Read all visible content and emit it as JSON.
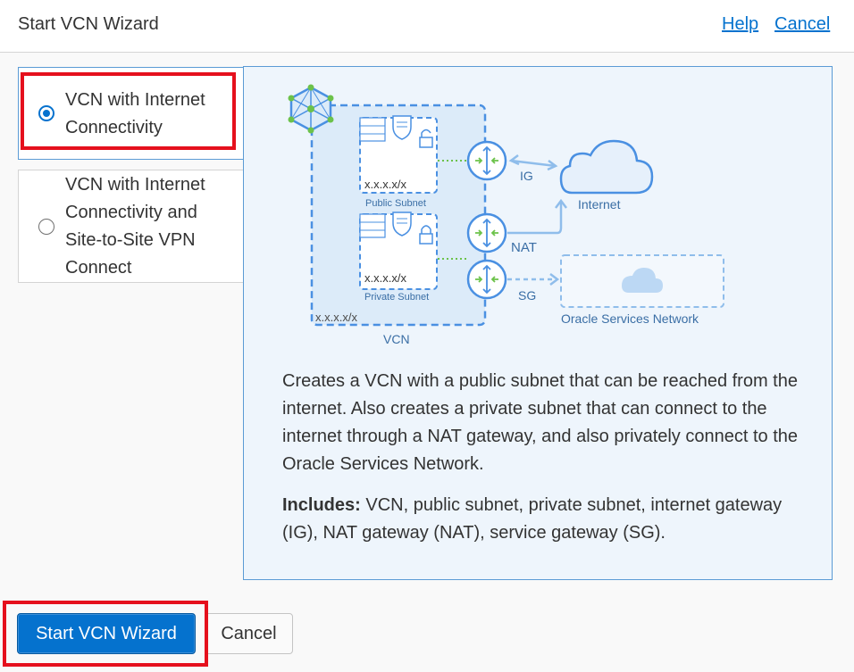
{
  "header": {
    "title": "Start VCN Wizard",
    "help_label": "Help",
    "cancel_label": "Cancel"
  },
  "options": [
    {
      "label": "VCN with Internet Connectivity",
      "selected": true
    },
    {
      "label": "VCN with Internet Connectivity and Site-to-Site VPN Connect",
      "selected": false
    }
  ],
  "diagram": {
    "public_subnet_cidr": "x.x.x.x/x",
    "public_subnet_label": "Public Subnet",
    "private_subnet_cidr": "x.x.x.x/x",
    "private_subnet_label": "Private Subnet",
    "vcn_cidr": "x.x.x.x/x",
    "vcn_label": "VCN",
    "ig_label": "IG",
    "nat_label": "NAT",
    "sg_label": "SG",
    "internet_label": "Internet",
    "osn_label": "Oracle Services Network"
  },
  "description": "Creates a VCN with a public subnet that can be reached from the internet. Also creates a private subnet that can connect to the internet through a NAT gateway, and also privately connect to the Oracle Services Network.",
  "includes": {
    "label": "Includes:",
    "text": " VCN, public subnet, private subnet, internet gateway (IG), NAT gateway (NAT), service gateway (SG)."
  },
  "footer": {
    "start_label": "Start VCN Wizard",
    "cancel_label": "Cancel"
  },
  "colors": {
    "accent": "#0572ce",
    "highlight": "#e5101d",
    "diagram_blue": "#4a90e2",
    "diagram_green": "#6cc24a"
  }
}
